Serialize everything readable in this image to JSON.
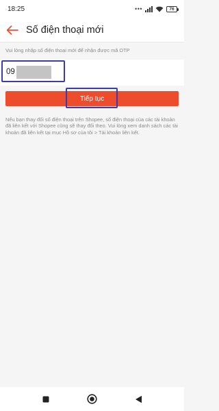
{
  "status_bar": {
    "time": "18:25",
    "dots": "•••",
    "icons": [
      "signal-icon",
      "wifi-icon",
      "battery-icon"
    ],
    "battery_level": "76"
  },
  "app_bar": {
    "back_icon": "arrow-left-icon",
    "title": "Số điện thoại mới"
  },
  "form": {
    "hint": "Vui lòng nhập số điện thoại mới để nhận được mã OTP",
    "phone_value_prefix": "09",
    "continue_label": "Tiếp tục"
  },
  "notice": "Nếu bạn thay đổi số điện thoại trên Shopee, số điện thoại của các tài khoản đã liên kết với Shopee cũng sẽ thay đổi theo. Vui lòng xem danh sách các tài khoản đã liên kết tại mục Hồ sơ của tôi > Tài khoản liên kết.",
  "nav_bar": {
    "icons": [
      "recents-square-icon",
      "home-circle-icon",
      "back-triangle-icon"
    ]
  },
  "colors": {
    "brand": "#ee4d2d",
    "highlight": "#3d3aaa",
    "hint_text": "#8a8a8a"
  }
}
